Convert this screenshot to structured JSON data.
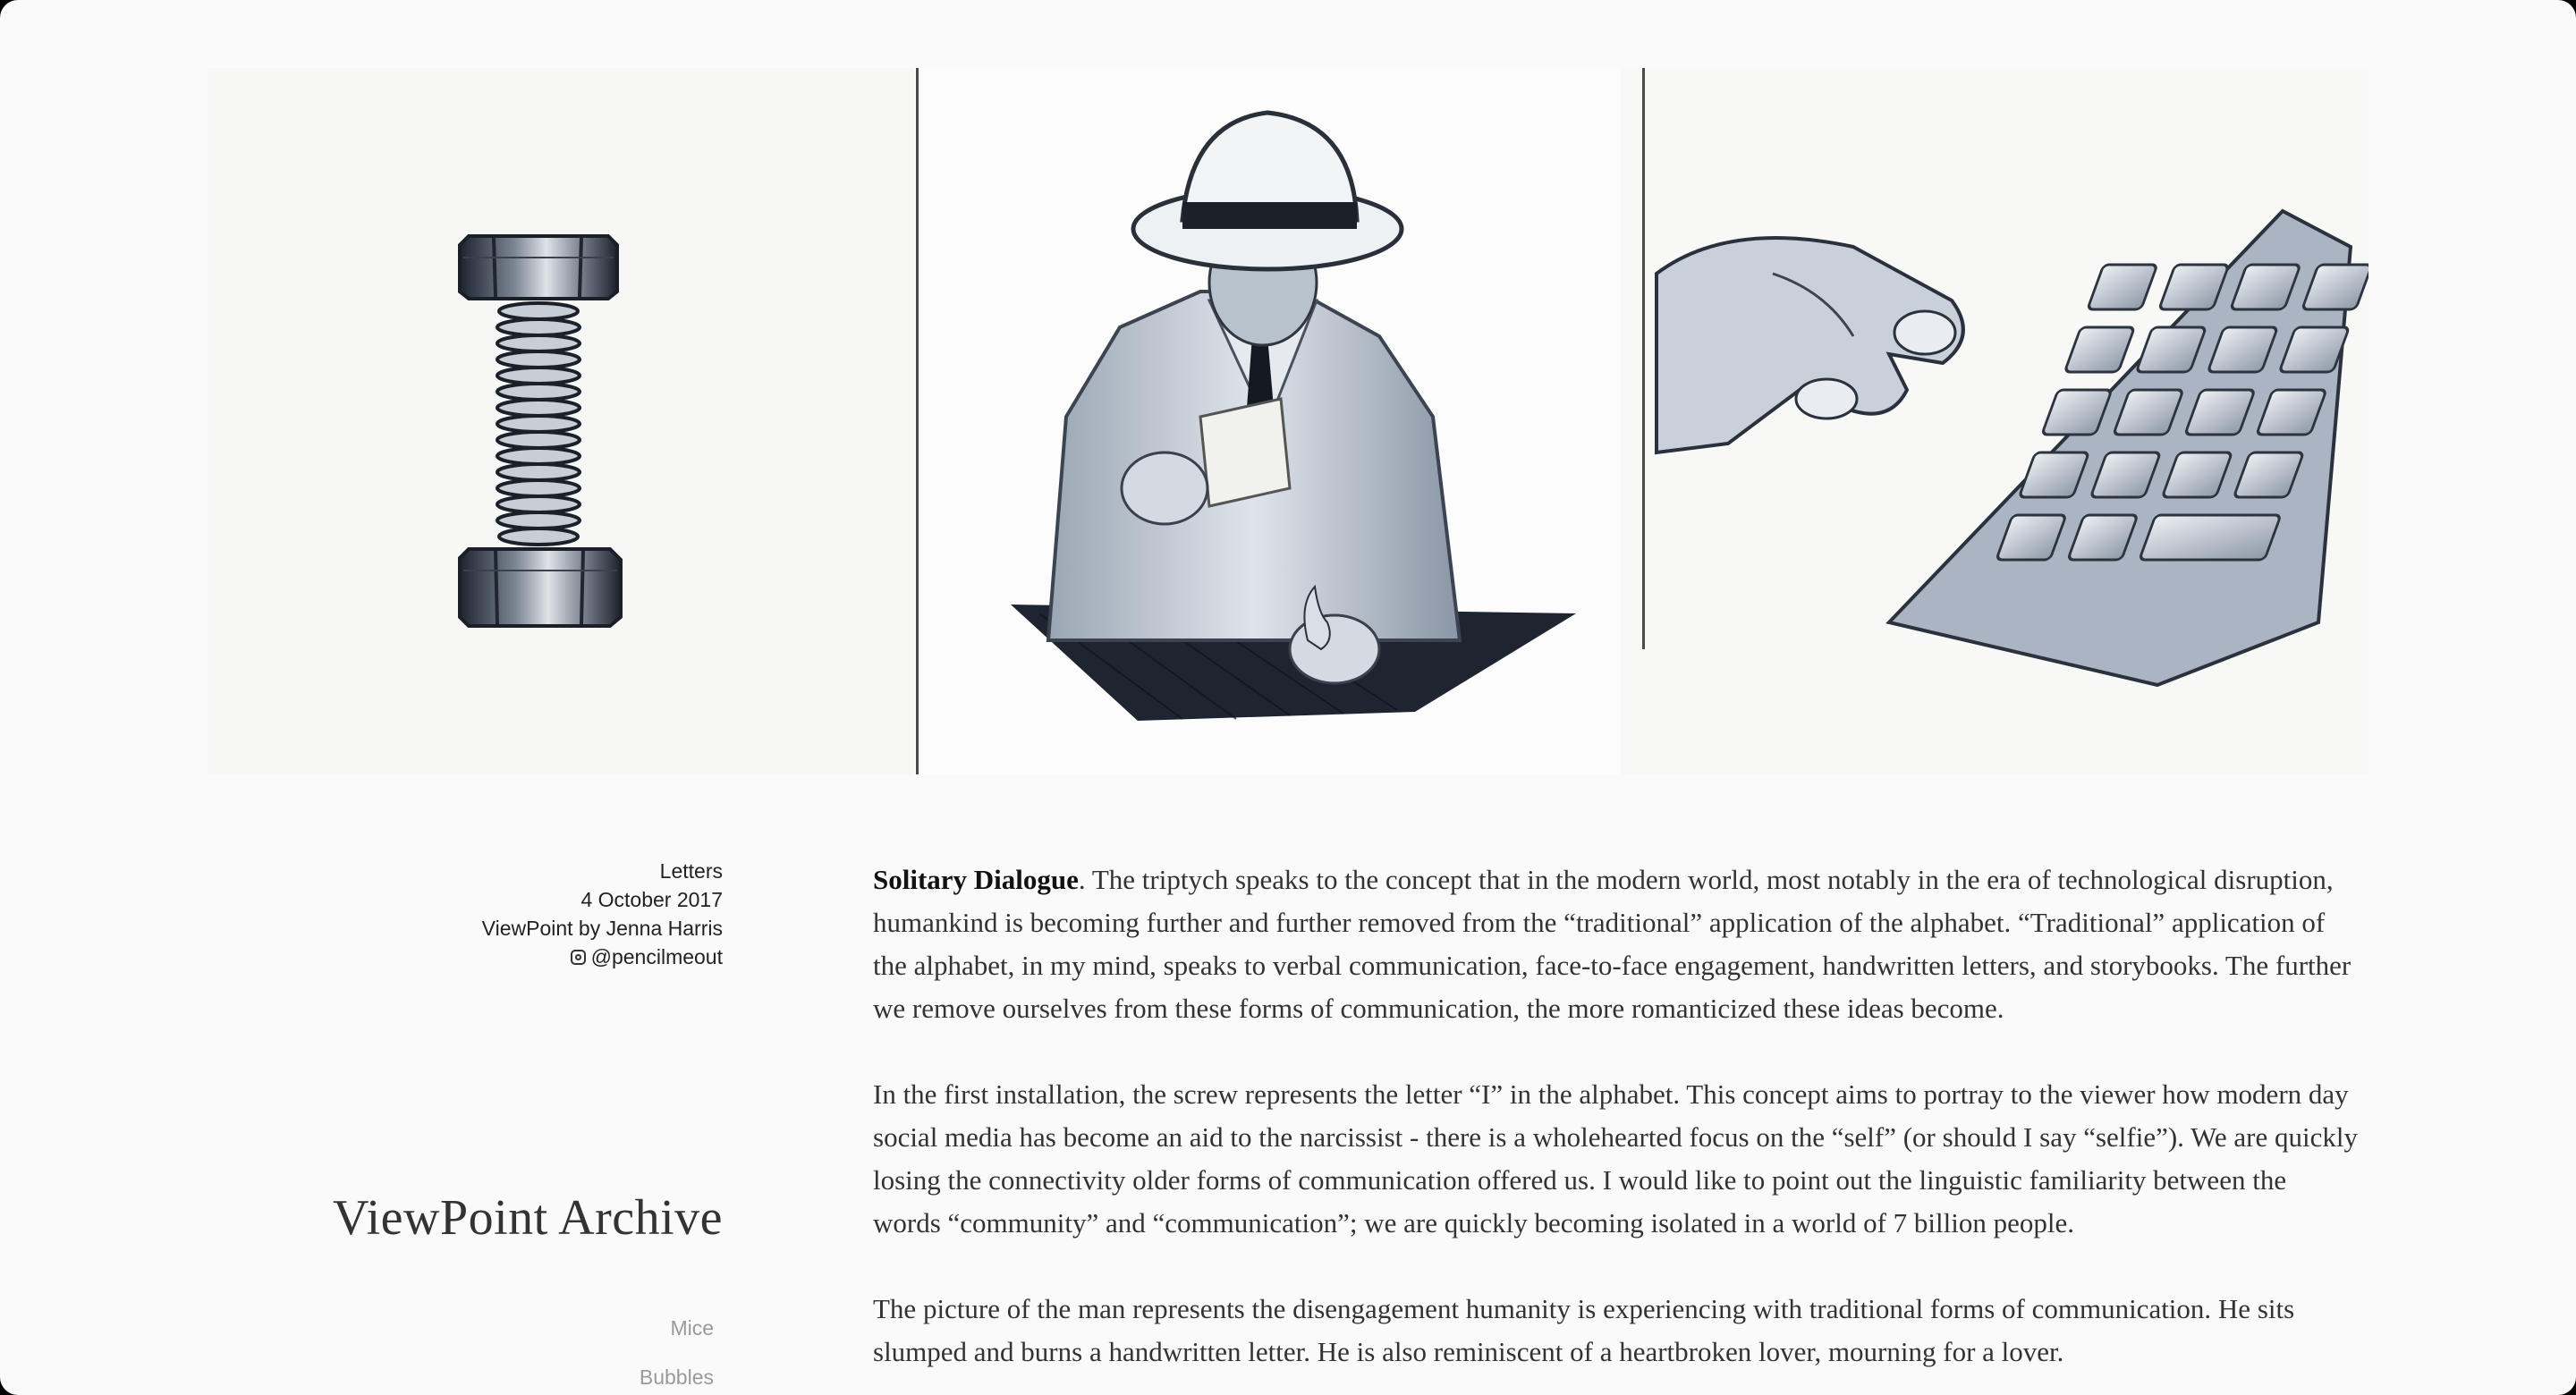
{
  "triptych": {
    "panels": [
      {
        "subject": "screw-illustration"
      },
      {
        "subject": "man-burning-letter-illustration"
      },
      {
        "subject": "hand-on-keyboard-illustration"
      }
    ]
  },
  "meta": {
    "category": "Letters",
    "date": "4 October 2017",
    "byline": "ViewPoint by Jenna Harris",
    "instagram_handle": "@pencilmeout",
    "instagram_icon": "instagram-icon"
  },
  "archive": {
    "title": "ViewPoint Archive",
    "items": [
      "Mice",
      "Bubbles"
    ]
  },
  "article": {
    "title": "Solitary Dialogue",
    "p1_rest": ". The triptych speaks to the concept that in the modern world, most notably in the era of technological disruption, humankind is becoming further and further removed from the “traditional” application of the alphabet. “Traditional” application of the alphabet, in my mind, speaks to verbal communication, face-to-face engagement, handwritten letters, and storybooks. The further we remove ourselves from these forms of communication, the more romanticized these ideas become.",
    "p2": "In the first installation, the screw represents the letter “I” in the alphabet. This concept aims to portray to the viewer how modern day social media has become an aid to the narcissist - there is a wholehearted focus on the “self” (or should I say “selfie”). We are quickly losing the connectivity older forms of communication offered us. I would like to point out the linguistic familiarity between the words “community” and “communication”; we are quickly becoming isolated in a world of 7 billion people.",
    "p3": "The picture of the man represents the disengagement humanity is experiencing with traditional forms of communication. He sits slumped and burns a handwritten letter. He is also reminiscent of a heartbroken lover, mourning for a lover."
  }
}
